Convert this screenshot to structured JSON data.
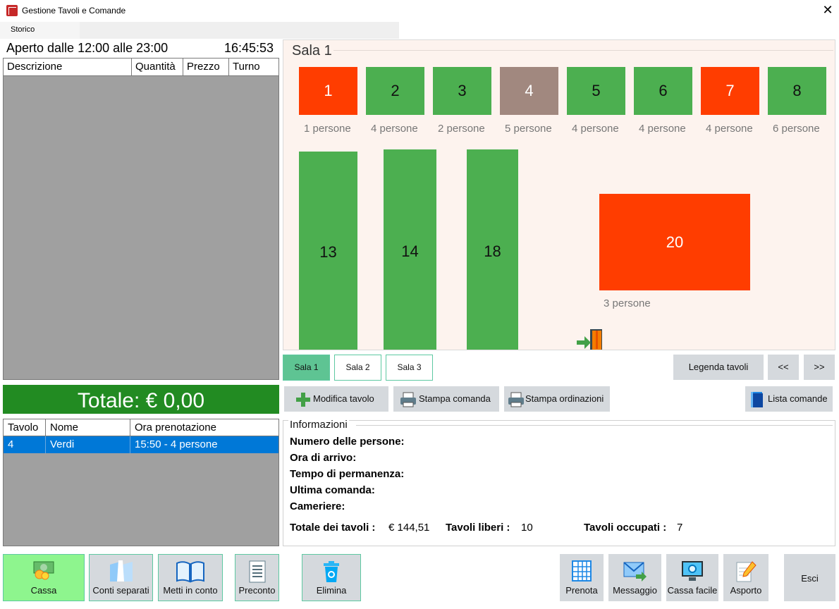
{
  "window": {
    "title": "Gestione Tavoli e Comande",
    "close_symbol": "✕"
  },
  "menu": {
    "storico": "Storico"
  },
  "left": {
    "aperto": "Aperto dalle 12:00 alle 23:00",
    "clock": "16:45:53",
    "order_columns": [
      "Descrizione",
      "Quantità",
      "Prezzo",
      "Turno"
    ],
    "totale": "Totale: € 0,00",
    "res_columns": [
      "Tavolo",
      "Nome",
      "Ora prenotazione"
    ],
    "res_rows": [
      {
        "tavolo": "4",
        "nome": "Verdi",
        "ora": "15:50 - 4 persone"
      }
    ]
  },
  "sala": {
    "title": "Sala 1",
    "colors": {
      "occupied": "#ff3d00",
      "free": "#4caf50",
      "reserved": "#a1887f"
    },
    "tables": [
      {
        "number": "1",
        "status": "occupied",
        "persone": "1 persone"
      },
      {
        "number": "2",
        "status": "free",
        "persone": "4 persone"
      },
      {
        "number": "3",
        "status": "free",
        "persone": "2 persone"
      },
      {
        "number": "4",
        "status": "reserved",
        "persone": "5 persone"
      },
      {
        "number": "5",
        "status": "free",
        "persone": "4 persone"
      },
      {
        "number": "6",
        "status": "free",
        "persone": "4 persone"
      },
      {
        "number": "7",
        "status": "occupied",
        "persone": "4 persone"
      },
      {
        "number": "8",
        "status": "free",
        "persone": "6 persone"
      },
      {
        "number": "13",
        "status": "free"
      },
      {
        "number": "14",
        "status": "free"
      },
      {
        "number": "18",
        "status": "free"
      },
      {
        "number": "20",
        "status": "occupied",
        "persone": "3 persone"
      }
    ]
  },
  "tabs": [
    "Sala 1",
    "Sala 2",
    "Sala 3"
  ],
  "nav": {
    "legenda": "Legenda tavoli",
    "prev": "<<",
    "next": ">>"
  },
  "tools": {
    "modifica": "Modifica tavolo",
    "stampa_comanda": "Stampa comanda",
    "stampa_ordinazioni": "Stampa ordinazioni",
    "lista_comande": "Lista comande"
  },
  "info": {
    "title": "Informazioni",
    "numero_persone": "Numero delle persone:",
    "ora_arrivo": "Ora di arrivo:",
    "tempo_permanenza": "Tempo di permanenza:",
    "ultima_comanda": "Ultima comanda:",
    "cameriere": "Cameriere:",
    "totale_label": "Totale dei tavoli :",
    "totale_value": "€ 144,51",
    "liberi_label": "Tavoli liberi :",
    "liberi_value": "10",
    "occupati_label": "Tavoli occupati :",
    "occupati_value": "7"
  },
  "bottom": {
    "cassa": "Cassa",
    "conti_separati": "Conti separati",
    "metti_in_conto": "Metti in conto",
    "preconto": "Preconto",
    "elimina": "Elimina",
    "prenota": "Prenota",
    "messaggio": "Messaggio",
    "cassa_facile": "Cassa facile",
    "asporto": "Asporto",
    "esci": "Esci"
  }
}
